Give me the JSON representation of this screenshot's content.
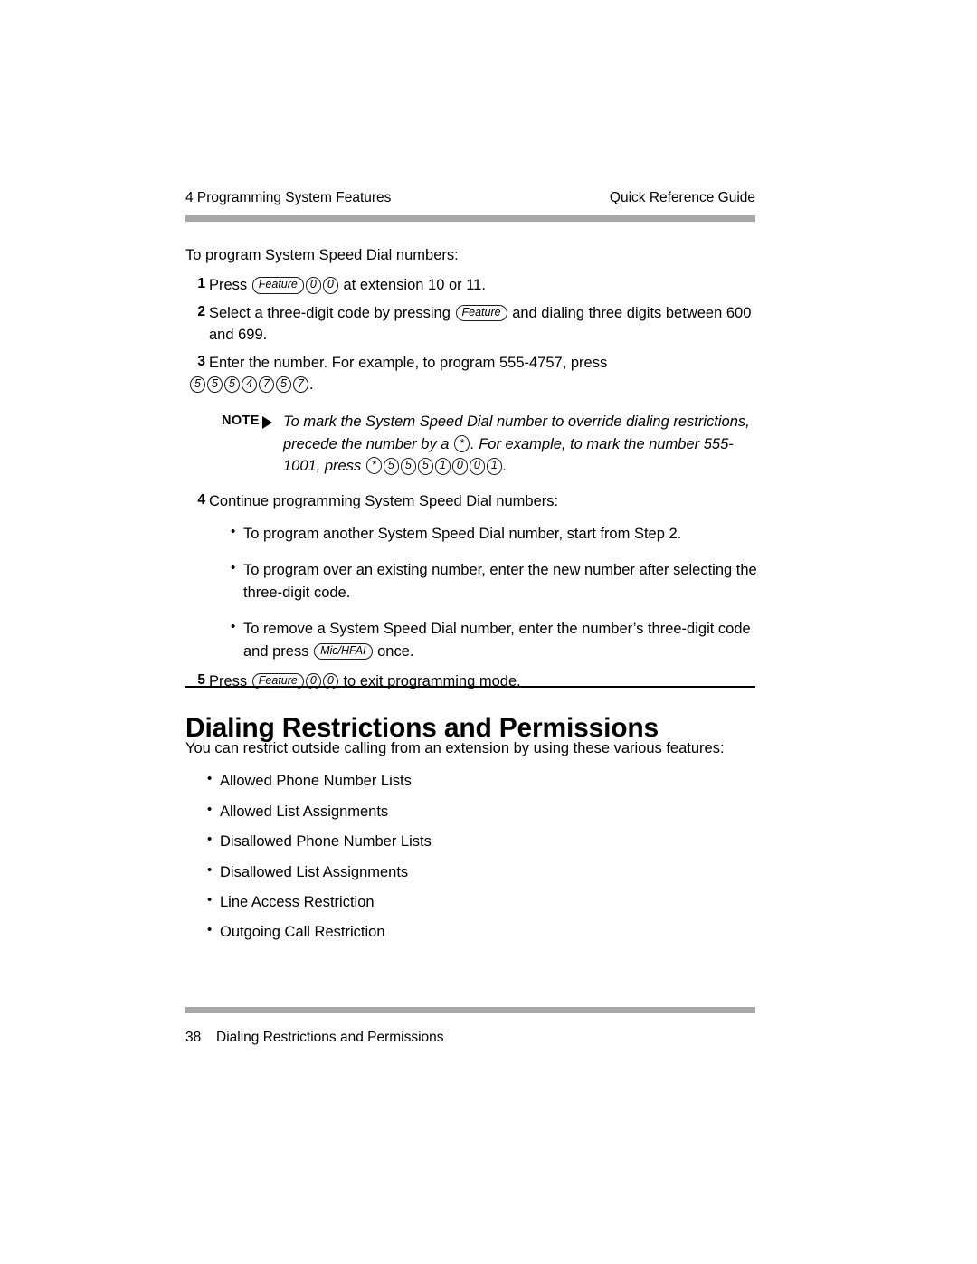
{
  "header": {
    "left": "4 Programming System Features",
    "right": "Quick Reference Guide"
  },
  "footer": {
    "page_number": "38",
    "title": "Dialing Restrictions and Permissions"
  },
  "body": {
    "intro": "To program System Speed Dial numbers:",
    "steps": [
      {
        "num": "1",
        "pre": "Press",
        "keys": [
          "Feature",
          "0",
          "0"
        ],
        "post": "at extension 10 or 11."
      },
      {
        "num": "2",
        "pre": "Select a three-digit code by pressing",
        "keys": [
          "Feature"
        ],
        "post": "and dialing three digits between 600 and 699."
      },
      {
        "num": "3",
        "pre": "Enter the number. For example, to program 555-4757, press",
        "keys": [
          "5",
          "5",
          "5",
          "4",
          "7",
          "5",
          "7"
        ],
        "post": "."
      }
    ],
    "note": {
      "label": "NOTE",
      "text_1": "To mark the System Speed Dial number to override dialing restrictions, precede the number by a",
      "star_key": "*",
      "text_2": ". For example, to mark the number 555-1001, press",
      "keys": [
        "*",
        "5",
        "5",
        "5",
        "1",
        "0",
        "0",
        "1"
      ],
      "text_3": "."
    },
    "step4": {
      "num": "4",
      "text": "Continue programming System Speed Dial numbers:"
    },
    "step4_bullets": [
      {
        "pre": "To program another System Speed Dial number, start from Step 2.",
        "keys": [],
        "post": ""
      },
      {
        "pre": "To program over an existing number, enter the new number after selecting the three-digit code.",
        "keys": [],
        "post": ""
      },
      {
        "pre": "To remove a System Speed Dial number, enter the number’s three-digit code and press",
        "keys": [
          "Mic/HFAI"
        ],
        "post": "once."
      }
    ],
    "step5": {
      "num": "5",
      "pre": "Press",
      "keys": [
        "Feature",
        "0",
        "0"
      ],
      "post": "to exit programming mode."
    }
  },
  "section": {
    "heading": "Dialing Restrictions and Permissions",
    "intro": "You can restrict outside calling from an extension by using these various features:",
    "features": [
      "Allowed Phone Number Lists",
      "Allowed List Assignments",
      "Disallowed Phone Number Lists",
      "Disallowed List Assignments",
      "Line Access Restriction",
      "Outgoing Call Restriction"
    ]
  }
}
